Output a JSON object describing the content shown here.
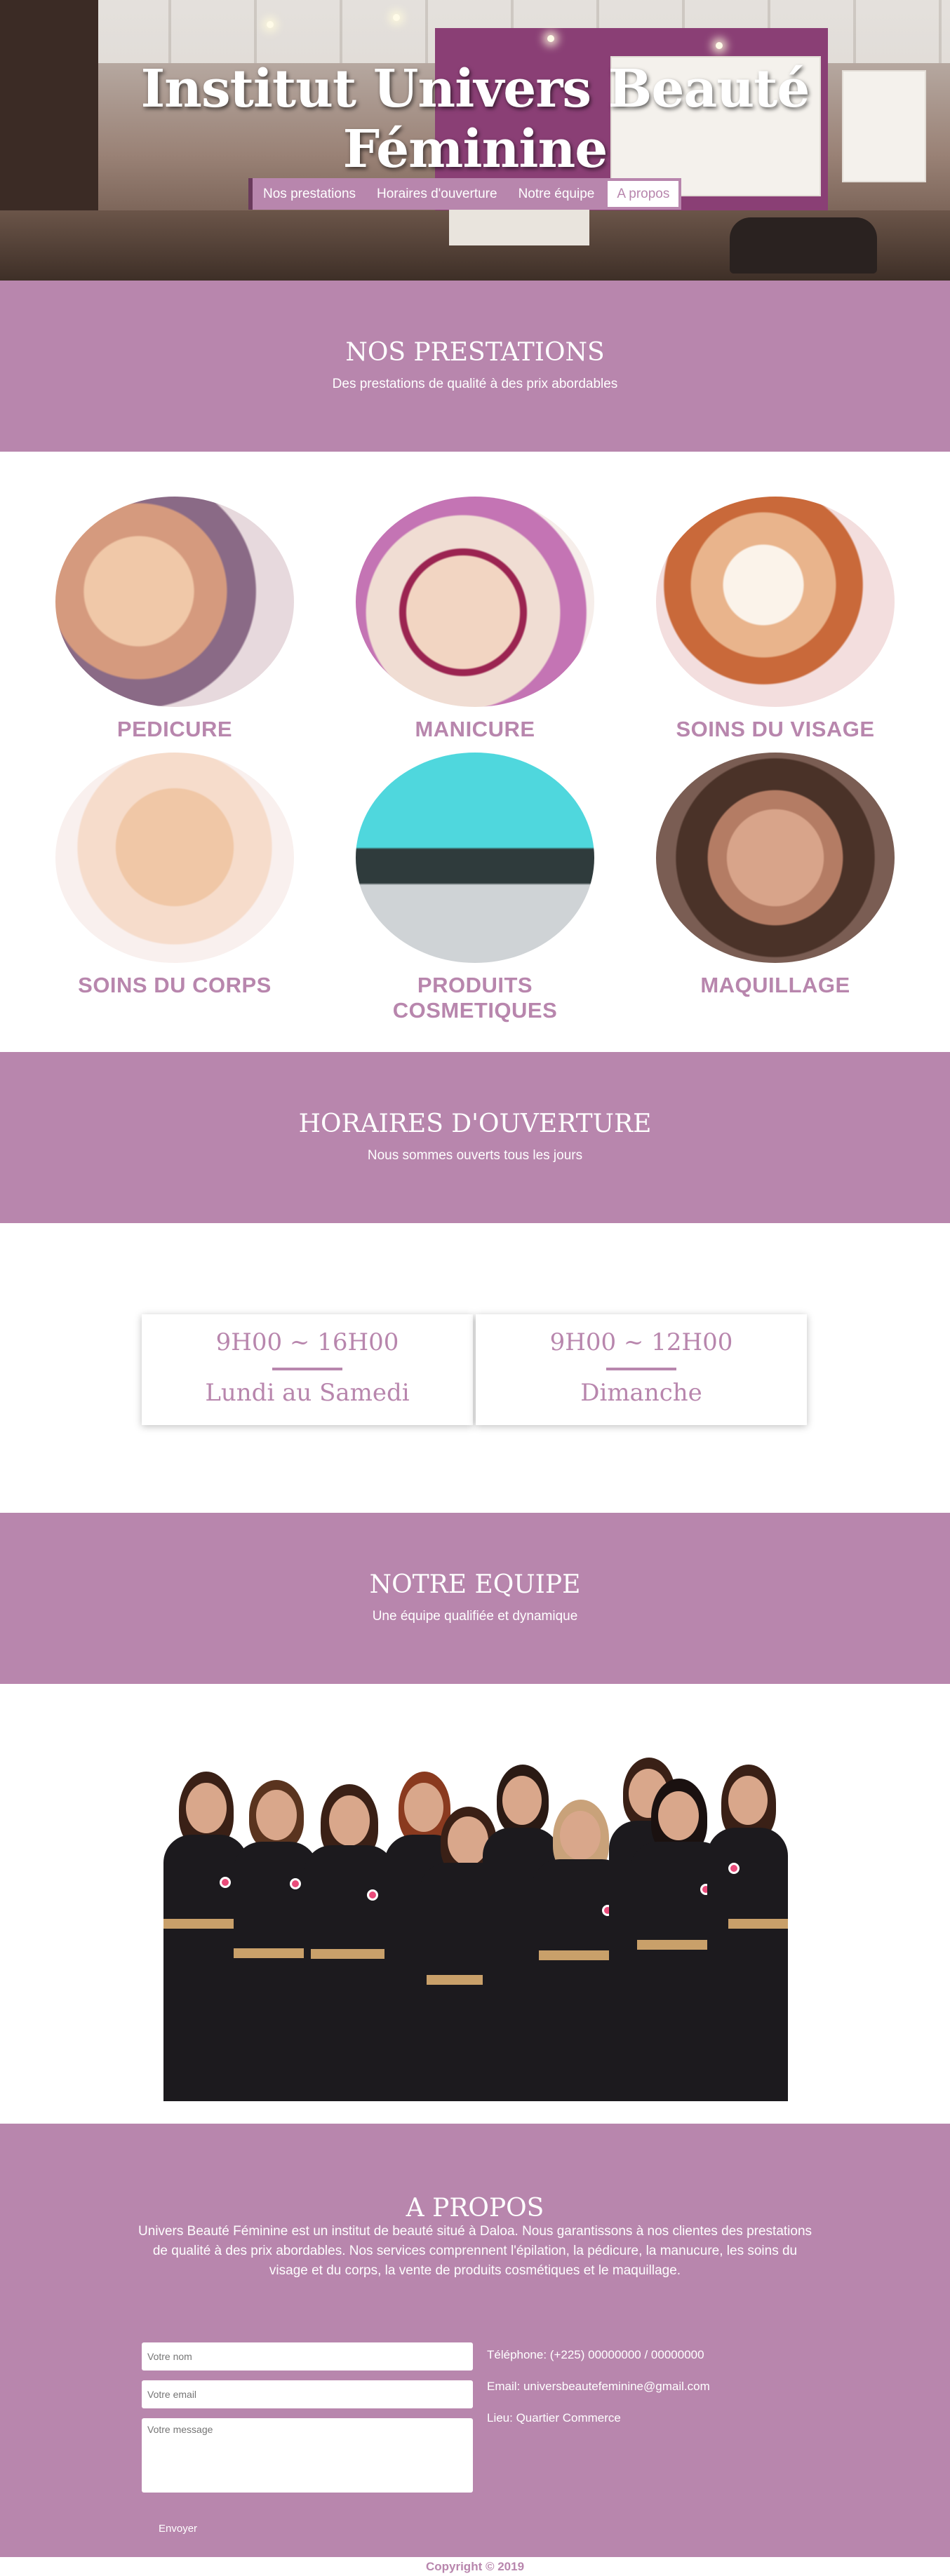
{
  "hero": {
    "title": "Institut Univers Beauté Féminine",
    "nav": [
      {
        "label": "Nos prestations"
      },
      {
        "label": "Horaires d'ouverture"
      },
      {
        "label": "Notre équipe"
      },
      {
        "label": "A propos"
      }
    ]
  },
  "prestations": {
    "title": "NOS PRESTATIONS",
    "subtitle": "Des prestations de qualité à des prix abordables",
    "services": [
      {
        "label": "PEDICURE"
      },
      {
        "label": "MANICURE"
      },
      {
        "label": "SOINS DU VISAGE"
      },
      {
        "label": "SOINS DU CORPS"
      },
      {
        "label": "PRODUITS COSMETIQUES"
      },
      {
        "label": "MAQUILLAGE"
      }
    ]
  },
  "horaires": {
    "title": "HORAIRES D'OUVERTURE",
    "subtitle": "Nous sommes ouverts tous les jours",
    "cards": [
      {
        "time": "9H00 ~ 16H00",
        "days": "Lundi au Samedi"
      },
      {
        "time": "9H00 ~ 12H00",
        "days": "Dimanche"
      }
    ]
  },
  "equipe": {
    "title": "NOTRE EQUIPE",
    "subtitle": "Une équipe qualifiée et dynamique"
  },
  "apropos": {
    "title": "A PROPOS",
    "description": "Univers Beauté Féminine est un institut de beauté situé à Daloa. Nous garantissons à nos clientes des prestations de qualité à des prix abordables. Nos services comprennent l'épilation, la pédicure, la manucure, les soins du visage et du corps, la vente de produits cosmétiques et le maquillage.",
    "form": {
      "name_placeholder": "Votre nom",
      "email_placeholder": "Votre email",
      "message_placeholder": "Votre message",
      "send_label": "Envoyer"
    },
    "contact": {
      "phone": "Téléphone: (+225) 00000000 / 00000000",
      "email": "Email: universbeautefeminine@gmail.com",
      "location": "Lieu: Quartier Commerce"
    }
  },
  "footer": {
    "copyright": "Copyright © 2019"
  },
  "colors": {
    "brand": "#b886ad",
    "white": "#ffffff"
  }
}
